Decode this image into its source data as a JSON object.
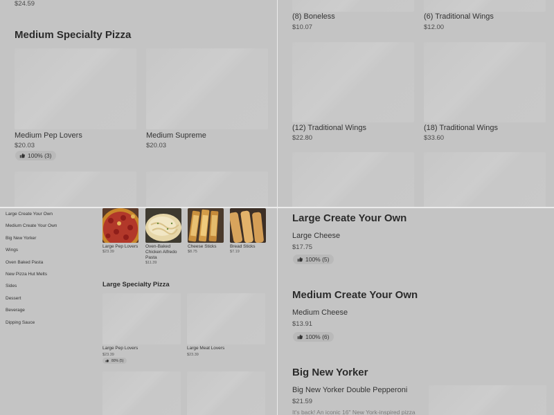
{
  "top_left": {
    "prev_price": "$24.59",
    "section_title": "Medium Specialty Pizza",
    "items": [
      {
        "name": "Medium Pep Lovers",
        "price": "$20.03",
        "rating": "100% (3)"
      },
      {
        "name": "Medium Supreme",
        "price": "$20.03"
      }
    ]
  },
  "top_right": {
    "items": [
      {
        "name": "(8) Boneless",
        "price": "$10.07"
      },
      {
        "name": "(6) Traditional Wings",
        "price": "$12.00"
      },
      {
        "name": "(12) Traditional Wings",
        "price": "$22.80"
      },
      {
        "name": "(18) Traditional Wings",
        "price": "$33.60"
      }
    ]
  },
  "bottom_left": {
    "sidebar": [
      "Large Create Your Own",
      "Medium Create Your Own",
      "Big New Yorker",
      "Wings",
      "Oven Baked Pasta",
      "New Pizza Hut Melts",
      "Sides",
      "Dessert",
      "Beverage",
      "Dipping Sauce"
    ],
    "featured": [
      {
        "name": "Large Pep Lovers",
        "price": "$23.39"
      },
      {
        "name": "Oven-Baked Chicken Alfredo Pasta",
        "price": "$11.39"
      },
      {
        "name": "Cheese Sticks",
        "price": "$8.75"
      },
      {
        "name": "Bread Sticks",
        "price": "$7.19"
      }
    ],
    "section_title": "Large Specialty Pizza",
    "items": [
      {
        "name": "Large Pep Lovers",
        "price": "$23.39",
        "rating": "80% (5)"
      },
      {
        "name": "Large Meat Lovers",
        "price": "$23.39"
      }
    ]
  },
  "bottom_right": {
    "sections": [
      {
        "title": "Large Create Your Own",
        "item": "Large Cheese",
        "price": "$17.75",
        "rating": "100% (5)"
      },
      {
        "title": "Medium Create Your Own",
        "item": "Medium Cheese",
        "price": "$13.91",
        "rating": "100% (6)"
      },
      {
        "title": "Big New Yorker",
        "item": "Big New Yorker Double Pepperoni",
        "price": "$21.59",
        "description": "It's back! An iconic 16\" New York-inspired pizza"
      }
    ]
  },
  "icons": {
    "rating": "thumbs-up-icon"
  },
  "colors": {
    "overlay": "#c4c4c4",
    "divider": "#ececec",
    "badge": "#b9b9b9"
  }
}
